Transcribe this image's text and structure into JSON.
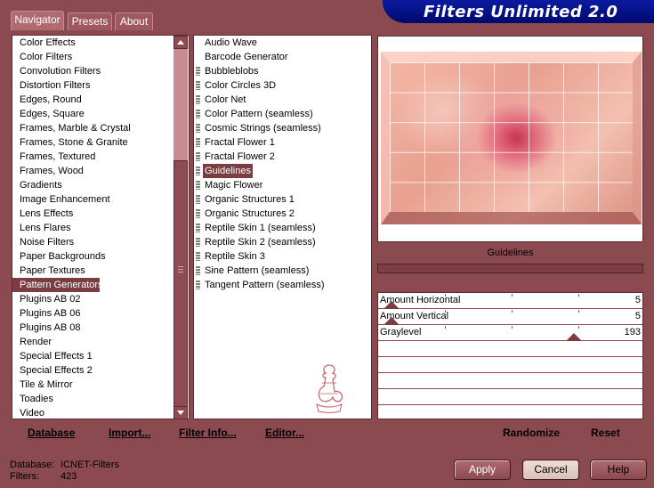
{
  "tabs": [
    "Navigator",
    "Presets",
    "About"
  ],
  "banner": "Filters Unlimited 2.0",
  "categories": [
    "Color Effects",
    "Color Filters",
    "Convolution Filters",
    "Distortion Filters",
    "Edges, Round",
    "Edges, Square",
    "Frames, Marble & Crystal",
    "Frames, Stone & Granite",
    "Frames, Textured",
    "Frames, Wood",
    "Gradients",
    "Image Enhancement",
    "Lens Effects",
    "Lens Flares",
    "Noise Filters",
    "Paper Backgrounds",
    "Paper Textures",
    "Pattern Generators",
    "Plugins AB 02",
    "Plugins AB 06",
    "Plugins AB 08",
    "Render",
    "Special Effects 1",
    "Special Effects 2",
    "Tile & Mirror",
    "Toadies",
    "Video"
  ],
  "selected_category": "Pattern Generators",
  "filters": [
    "Audio Wave",
    "Barcode Generator",
    "Bubbleblobs",
    "Color Circles 3D",
    "Color Net",
    "Color Pattern (seamless)",
    "Cosmic Strings (seamless)",
    "Fractal Flower 1",
    "Fractal Flower 2",
    "Guidelines",
    "Magic Flower",
    "Organic Structures 1",
    "Organic Structures 2",
    "Reptile Skin 1 (seamless)",
    "Reptile Skin 2 (seamless)",
    "Reptile Skin 3",
    "Sine Pattern (seamless)",
    "Tangent Pattern (seamless)"
  ],
  "selected_filter": "Guidelines",
  "filter_title": "Guidelines",
  "sliders": [
    {
      "label": "Amount Horizontal",
      "value": "5",
      "level": 0.02
    },
    {
      "label": "Amount Vertical",
      "value": "5",
      "level": 0.02
    },
    {
      "label": "Graylevel",
      "value": "193",
      "level": 0.757
    }
  ],
  "actions": {
    "database": "Database",
    "import": "Import...",
    "filter_info": "Filter Info...",
    "editor": "Editor...",
    "randomize": "Randomize",
    "reset": "Reset"
  },
  "status": {
    "database_label": "Database:",
    "database_value": "ICNET-Filters",
    "filters_label": "Filters:",
    "filters_value": "423"
  },
  "buttons": {
    "apply": "Apply",
    "cancel": "Cancel",
    "help": "Help"
  },
  "colors": {
    "selection": "#7a3d42",
    "background": "#8a4a50",
    "banner": "#0c1aa0"
  }
}
